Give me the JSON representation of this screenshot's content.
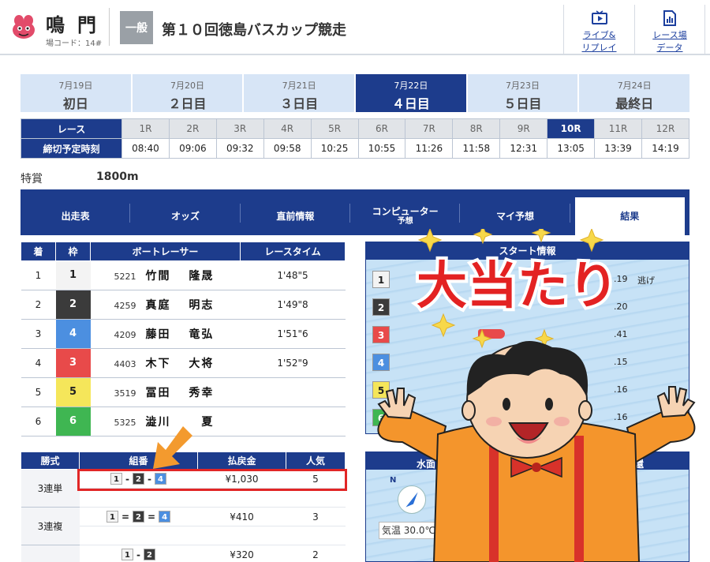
{
  "header": {
    "venue_name": "鳴門",
    "venue_code": "場コード：14#",
    "grade": "一般",
    "race_title": "第１０回徳島バスカップ競走",
    "btn_live": [
      "ライブ&",
      "リプレイ"
    ],
    "btn_data": [
      "レース場",
      "データ"
    ]
  },
  "days": [
    {
      "date": "7月19日",
      "label": "初日",
      "active": false
    },
    {
      "date": "7月20日",
      "label": "２日目",
      "active": false
    },
    {
      "date": "7月21日",
      "label": "３日目",
      "active": false
    },
    {
      "date": "7月22日",
      "label": "４日目",
      "active": true
    },
    {
      "date": "7月23日",
      "label": "５日目",
      "active": false
    },
    {
      "date": "7月24日",
      "label": "最終日",
      "active": false
    }
  ],
  "races": {
    "row1_label": "レース",
    "row2_label": "締切予定時刻",
    "numbers": [
      "1R",
      "2R",
      "3R",
      "4R",
      "5R",
      "6R",
      "7R",
      "8R",
      "9R",
      "10R",
      "11R",
      "12R"
    ],
    "times": [
      "08:40",
      "09:06",
      "09:32",
      "09:58",
      "10:25",
      "10:55",
      "11:26",
      "11:58",
      "12:31",
      "13:05",
      "13:39",
      "14:19"
    ],
    "active_index": 9
  },
  "race_info": {
    "type": "特賞",
    "distance": "1800m"
  },
  "nav": {
    "tabs": [
      {
        "label": "出走表",
        "sub": ""
      },
      {
        "label": "オッズ",
        "sub": ""
      },
      {
        "label": "直前情報",
        "sub": ""
      },
      {
        "label": "コンピューター",
        "sub": "予想"
      },
      {
        "label": "マイ予想",
        "sub": ""
      },
      {
        "label": "結果",
        "sub": ""
      }
    ],
    "active_index": 5
  },
  "results": {
    "headers": [
      "着",
      "枠",
      "ボートレーサー",
      "レースタイム"
    ],
    "rows": [
      {
        "place": "1",
        "frame": "1",
        "reg": "5221",
        "name": "竹間　 隆晟",
        "time": "1'48\"5"
      },
      {
        "place": "2",
        "frame": "2",
        "reg": "4259",
        "name": "真庭　 明志",
        "time": "1'49\"8"
      },
      {
        "place": "3",
        "frame": "4",
        "reg": "4209",
        "name": "藤田　 竜弘",
        "time": "1'51\"6"
      },
      {
        "place": "4",
        "frame": "3",
        "reg": "4403",
        "name": "木下　 大将",
        "time": "1'52\"9"
      },
      {
        "place": "5",
        "frame": "5",
        "reg": "3519",
        "name": "冨田　 秀幸",
        "time": ""
      },
      {
        "place": "6",
        "frame": "6",
        "reg": "5325",
        "name": "澁川　　 夏",
        "time": ""
      }
    ]
  },
  "start_info": {
    "title": "スタート情報",
    "lanes": [
      "1",
      "2",
      "3",
      "4",
      "5",
      "6"
    ],
    "st": [
      ".19",
      ".20",
      ".41",
      ".15",
      ".16",
      ".16"
    ],
    "note": "逃げ"
  },
  "payout": {
    "headers": [
      "勝式",
      "組番",
      "払戻金",
      "人気"
    ],
    "rows": [
      {
        "kind": "3連単",
        "combo": [
          "1",
          "-",
          "2",
          "-",
          "4"
        ],
        "amount": "¥1,030",
        "pop": "5"
      },
      {
        "kind": "3連複",
        "combo": [
          "1",
          "=",
          "2",
          "=",
          "4"
        ],
        "amount": "¥410",
        "pop": "3"
      },
      {
        "kind": "",
        "combo": [
          "1",
          "-",
          "2"
        ],
        "amount": "¥320",
        "pop": "2"
      }
    ]
  },
  "weather": {
    "title_left": "水面",
    "title_right": "返還",
    "compass_n": "N",
    "temp": "気温 30.0℃"
  },
  "overlay": {
    "banner": "大当たり"
  },
  "colors": {
    "navy": "#1d3c8c",
    "highlight": "#e12626",
    "frame1": "#f3f3f3",
    "frame2": "#3b3b3b",
    "frame3": "#e84a4a",
    "frame4": "#4c8fe0",
    "frame5": "#f5e65a",
    "frame6": "#3fb652"
  }
}
